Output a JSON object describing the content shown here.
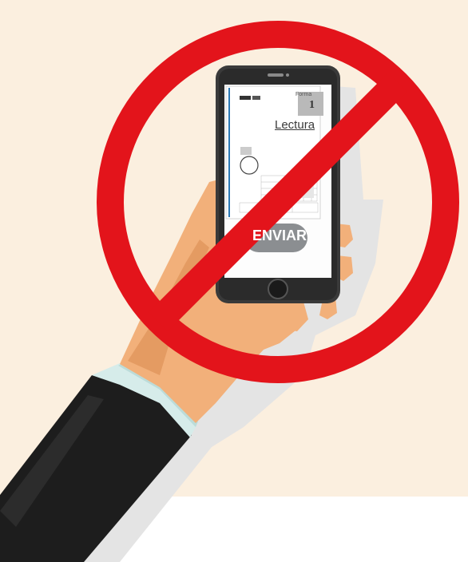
{
  "illustration": {
    "description_tags": [
      "prohibition-sign",
      "smartphone",
      "hand",
      "exam-form"
    ],
    "colors": {
      "background": "#fbefdf",
      "prohibition_red": "#e3141b",
      "phone_body": "#3a3a3a",
      "skin": "#f2b27a",
      "sleeve": "#1c1c1c",
      "cuff": "#d7ecea",
      "shadow": "#e2e2e2",
      "button_gray": "#8b8e91"
    }
  },
  "phone_screen": {
    "form_label": "Forma",
    "form_number": "1",
    "document_title": "Lectura",
    "send_button_label": "ENVIAR"
  }
}
